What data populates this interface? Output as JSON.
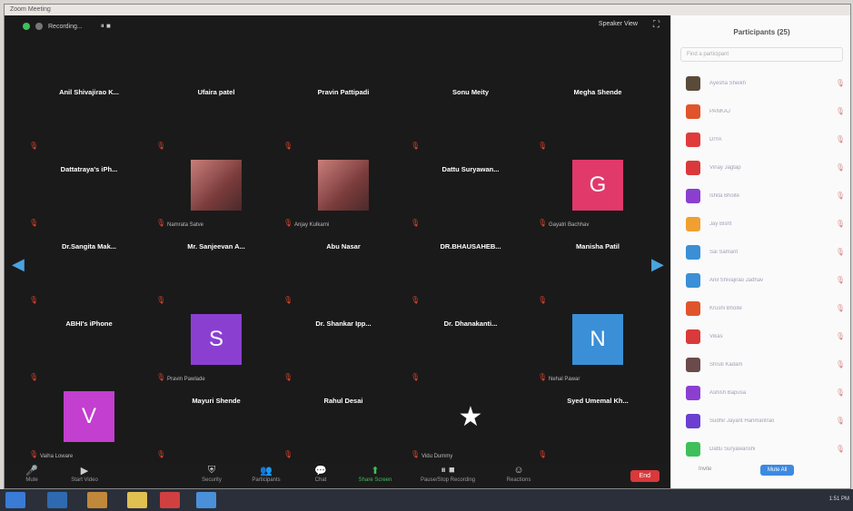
{
  "window": {
    "title": "Zoom Meeting"
  },
  "topbar": {
    "recording": "Recording...",
    "speaker_view": "Speaker View"
  },
  "tiles": [
    {
      "name": "Anil Shivajirao K..."
    },
    {
      "name": "Ufaira patel"
    },
    {
      "name": "Pravin Pattipadi"
    },
    {
      "name": "Sonu Meity"
    },
    {
      "name": "Megha Shende"
    },
    {
      "name": "Dattatraya's iPh..."
    },
    {
      "name": "",
      "caption": "Namrata Satve",
      "photo": true
    },
    {
      "name": "",
      "caption": "Anjay Kulkarni",
      "photo": true
    },
    {
      "name": "Dattu Suryawan..."
    },
    {
      "name": "",
      "caption": "Gayatri Bachhav",
      "avatar": "G",
      "avatar_color": "#e0396a"
    },
    {
      "name": "Dr.Sangita Mak..."
    },
    {
      "name": "Mr. Sanjeevan A..."
    },
    {
      "name": "Abu Nasar"
    },
    {
      "name": "DR.BHAUSAHEB..."
    },
    {
      "name": "Manisha Patil"
    },
    {
      "name": "ABHI's iPhone"
    },
    {
      "name": "",
      "caption": "Pravin Pawlade",
      "avatar": "S",
      "avatar_color": "#8a3fd1"
    },
    {
      "name": "Dr. Shankar Ipp..."
    },
    {
      "name": "Dr. Dhanakanti..."
    },
    {
      "name": "",
      "caption": "Nehal Pawar",
      "avatar": "N",
      "avatar_color": "#3a8fd6"
    },
    {
      "name": "",
      "caption": "Vaiha Loware",
      "avatar": "V",
      "avatar_color": "#c23fcf"
    },
    {
      "name": "Mayuri Shende"
    },
    {
      "name": "Rahul Desai"
    },
    {
      "name": "",
      "caption": "Vidu Dummy",
      "star": true
    },
    {
      "name": "Syed Umemal Kh..."
    }
  ],
  "toolbar": {
    "mute": "Mute",
    "video": "Start Video",
    "security": "Security",
    "participants": "Participants",
    "chat": "Chat",
    "share": "Share Screen",
    "pause": "Pause/Stop Recording",
    "reactions": "Reactions",
    "end": "End"
  },
  "panel": {
    "title": "Participants (25)",
    "search_placeholder": "Find a participant",
    "participants": [
      {
        "name": "Ayesha Sheikh",
        "color": "#5a4a3a"
      },
      {
        "name": "PANKAJ",
        "color": "#e0542c"
      },
      {
        "name": "DIYA",
        "color": "#e03a3a"
      },
      {
        "name": "Vinay Jagtap",
        "color": "#d9393a"
      },
      {
        "name": "Ishita Bhoite",
        "color": "#8a3fd1"
      },
      {
        "name": "Jay Bisht",
        "color": "#f0a030"
      },
      {
        "name": "Sai Samant",
        "color": "#3a8fd6"
      },
      {
        "name": "Anil Shivajirao Jadhav",
        "color": "#3a8fd6"
      },
      {
        "name": "Krushi Bhoite",
        "color": "#e0542c"
      },
      {
        "name": "Vikas",
        "color": "#d9393a"
      },
      {
        "name": "Shruti Kadam",
        "color": "#6a4a4a"
      },
      {
        "name": "Ashish Bapusa",
        "color": "#8a3fd1"
      },
      {
        "name": "Sudhir Jayant Hanmantrao",
        "color": "#6a3fd1"
      },
      {
        "name": "Dattu Suryawanshi",
        "color": "#3fbf5a"
      }
    ],
    "invite": "Invite",
    "mute_all": "Mute All"
  },
  "taskbar": {
    "clock": "1:51 PM"
  }
}
